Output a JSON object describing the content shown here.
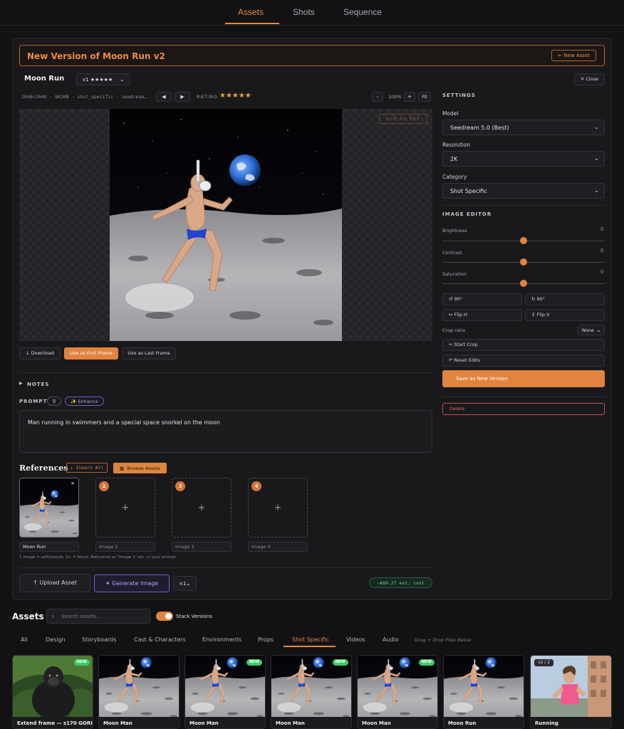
{
  "nav": {
    "tabs": [
      "Assets",
      "Shots",
      "Sequence"
    ]
  },
  "header": {
    "title": "New Version of Moon Run v2",
    "new_asset": "← New Asset"
  },
  "asset": {
    "name": "Moon Run",
    "version_select": "v1 ★★★★★",
    "close": "✕ Close",
    "meta": "2048×2048 · 902KB · shot_specific · seedream…",
    "rating_label": "RATING",
    "stars": "★★★★★",
    "zoom_minus": "-",
    "zoom_value": "100%",
    "zoom_plus": "+",
    "fit": "Fit",
    "use_as_ref": "USE AS REF",
    "download": "↓ Download",
    "first_frame": "Use as First Frame",
    "last_frame": "Use as Last Frame"
  },
  "notes": {
    "label": "NOTES",
    "arrow": "▶"
  },
  "prompt": {
    "label": "PROMPT",
    "enhance": "✨ Enhance",
    "text": "Man running in swimmers and a special space snorkel on the moon"
  },
  "references": {
    "title": "References",
    "insert_all": "↓ Insert All",
    "browse": "Browse Assets",
    "slots": [
      {
        "badge": "",
        "name": "Moon Run"
      },
      {
        "badge": "2",
        "name": "Image 2"
      },
      {
        "badge": "3",
        "name": "Image 3"
      },
      {
        "badge": "4",
        "name": "Image 4"
      }
    ],
    "hint": "1 image = edit/restyle. 2+ = blend. Reference as \"Image 1\" etc. in your prompt."
  },
  "actions": {
    "upload": "↑ Upload Asset",
    "generate": "✦ Generate Image",
    "count": "×1",
    "cost": "~A$0.27 est. cost"
  },
  "settings": {
    "title": "SETTINGS",
    "model_label": "Model",
    "model_value": "Seedream 5.0 (Best)",
    "resolution_label": "Resolution",
    "resolution_value": "2K",
    "category_label": "Category",
    "category_value": "Shot Specific"
  },
  "editor": {
    "title": "IMAGE EDITOR",
    "sliders": [
      {
        "label": "Brightness",
        "value": "0"
      },
      {
        "label": "Contrast",
        "value": "0"
      },
      {
        "label": "Saturation",
        "value": "0"
      }
    ],
    "rotate_ccw": "↺ 90°",
    "rotate_cw": "↻ 90°",
    "flip_h": "↔ Flip H",
    "flip_v": "↕ Flip V",
    "crop_ratio_label": "Crop ratio",
    "crop_ratio_value": "None",
    "start_crop": "✂ Start Crop",
    "reset_edits": "↶ Reset Edits",
    "save_version": "Save as New Version",
    "delete": "Delete"
  },
  "library": {
    "title": "Assets",
    "search_placeholder": "Search assets...",
    "stack_label": "Stack Versions",
    "stack_on": true,
    "tabs": [
      "All",
      "Design",
      "Storyboards",
      "Cast & Characters",
      "Environments",
      "Props",
      "Shot Specific",
      "Videos",
      "Audio"
    ],
    "active_tab": "Shot Specific",
    "drag_hint": "Drag + Drop Files Below",
    "cards": [
      {
        "name": "Extend frame — s170 GORI…",
        "badge": "NEW"
      },
      {
        "name": "Moon Man",
        "badge": ""
      },
      {
        "name": "Moon Man",
        "badge": "NEW"
      },
      {
        "name": "Moon Man",
        "badge": "NEW"
      },
      {
        "name": "Moon Man",
        "badge": "NEW"
      },
      {
        "name": "Moon Run",
        "badge": ""
      },
      {
        "name": "Running",
        "badge": "v2 / 2"
      }
    ]
  },
  "colors": {
    "accent": "#e8894a",
    "background": "#121214",
    "panel": "#19191c",
    "purple": "#8f6cff",
    "green": "#3ccb6a",
    "danger": "#e05a5a"
  }
}
